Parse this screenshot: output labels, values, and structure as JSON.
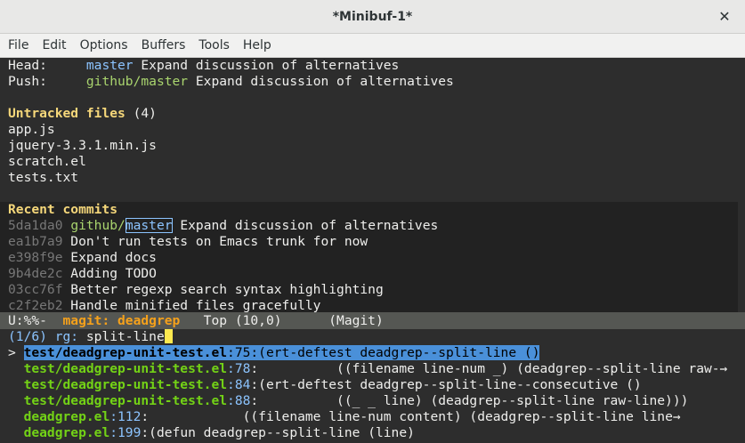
{
  "window": {
    "title": "*Minibuf-1*",
    "close_glyph": "✕"
  },
  "menu": [
    "File",
    "Edit",
    "Options",
    "Buffers",
    "Tools",
    "Help"
  ],
  "status": {
    "head_label": "Head:     ",
    "head_branch": "master",
    "head_msg": " Expand discussion of alternatives",
    "push_label": "Push:     ",
    "push_branch": "github/master",
    "push_msg": " Expand discussion of alternatives",
    "untracked_heading": "Untracked files",
    "untracked_count": " (4)",
    "untracked": [
      "app.js",
      "jquery-3.3.1.min.js",
      "scratch.el",
      "tests.txt"
    ],
    "recent_heading": "Recent commits",
    "first_commit": {
      "hash": "5da1da0",
      "remote": "github/",
      "branch": "master",
      "msg": " Expand discussion of alternatives"
    },
    "commits": [
      {
        "hash": "ea1b7a9",
        "msg": " Don't run tests on Emacs trunk for now"
      },
      {
        "hash": "e398f9e",
        "msg": " Expand docs"
      },
      {
        "hash": "9b4de2c",
        "msg": " Adding TODO"
      },
      {
        "hash": "03cc76f",
        "msg": " Better regexp search syntax highlighting"
      },
      {
        "hash": "c2f2eb2",
        "msg": " Handle minified files gracefully"
      }
    ]
  },
  "modeline": {
    "prefix": "U:%%-  ",
    "buffer": "magit: deadgrep",
    "rest": "   Top (10,0)      (Magit)"
  },
  "minibuffer": {
    "prompt": "(1/6) rg: ",
    "input": "split-line",
    "results": [
      {
        "marker": "> ",
        "file": "test/deadgrep-unit-test.el",
        "line": ":75",
        "text": ":(ert-deftest deadgrep--split-line ()",
        "selected": true
      },
      {
        "marker": "  ",
        "file": "test/deadgrep-unit-test.el",
        "line": ":78",
        "text": ":          ((filename line-num _) (deadgrep--split-line raw-→",
        "selected": false
      },
      {
        "marker": "  ",
        "file": "test/deadgrep-unit-test.el",
        "line": ":84",
        "text": ":(ert-deftest deadgrep--split-line--consecutive ()",
        "selected": false
      },
      {
        "marker": "  ",
        "file": "test/deadgrep-unit-test.el",
        "line": ":88",
        "text": ":          ((_ _ line) (deadgrep--split-line raw-line)))",
        "selected": false
      },
      {
        "marker": "  ",
        "file": "deadgrep.el",
        "line": ":112",
        "text": ":            ((filename line-num content) (deadgrep--split-line line→",
        "selected": false
      },
      {
        "marker": "  ",
        "file": "deadgrep.el",
        "line": ":199",
        "text": ":(defun deadgrep--split-line (line)",
        "selected": false
      }
    ]
  },
  "colors": {
    "accent": "#8cc4ff",
    "selection": "#4a90d9",
    "file": "#73d216",
    "heading": "#f5d77a"
  }
}
